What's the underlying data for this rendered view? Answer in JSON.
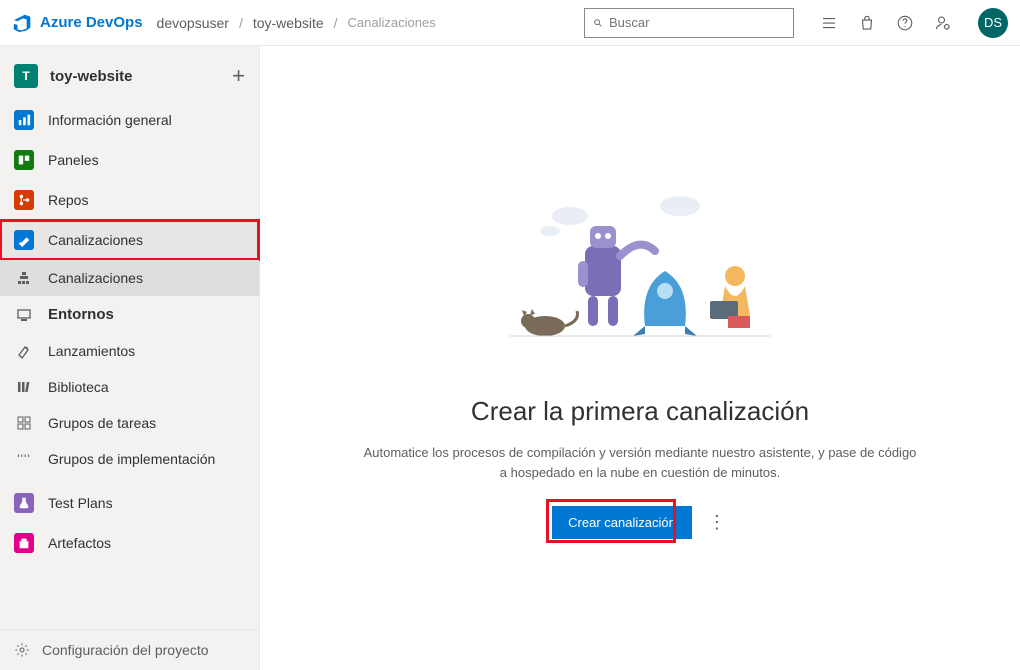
{
  "header": {
    "brand": "Azure DevOps",
    "breadcrumbs": [
      "devopsuser",
      "toy-website",
      "Canalizaciones"
    ],
    "search_placeholder": "Buscar",
    "avatar_initials": "DS"
  },
  "sidebar": {
    "project_initial": "T",
    "project_name": "toy-website",
    "nav": {
      "overview": "Información general",
      "boards": "Paneles",
      "repos": "Repos",
      "pipelines": "Canalizaciones",
      "tests": "Test Plans",
      "artifacts": "Artefactos"
    },
    "pipelines_sub": {
      "pipelines": "Canalizaciones",
      "environments": "Entornos",
      "releases": "Lanzamientos",
      "library": "Biblioteca",
      "taskgroups": "Grupos de tareas",
      "deploygroups": "Grupos de implementación"
    },
    "footer": "Configuración del proyecto"
  },
  "main": {
    "title": "Crear la primera canalización",
    "description": "Automatice los procesos de compilación y versión mediante nuestro asistente, y pase de código a hospedado en la nube en cuestión de minutos.",
    "cta": "Crear canalización"
  }
}
